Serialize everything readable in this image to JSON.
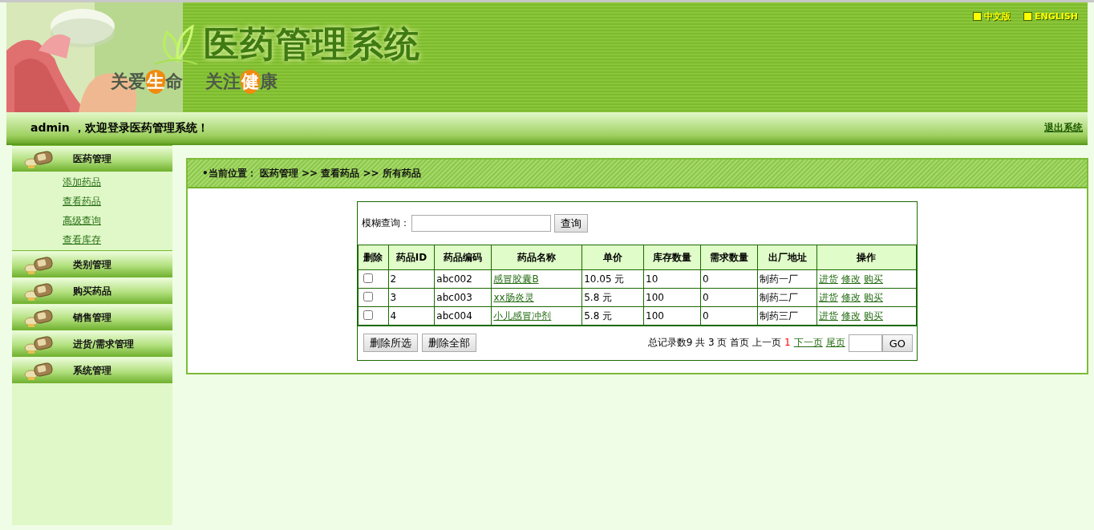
{
  "header": {
    "title": "医药管理系统",
    "slogan": [
      {
        "text": "关爱",
        "highlight": false
      },
      {
        "text": "生",
        "highlight": true
      },
      {
        "text": "命",
        "highlight": false
      },
      {
        "text": "关注",
        "highlight": false,
        "gap": true
      },
      {
        "text": "健",
        "highlight": true
      },
      {
        "text": "康",
        "highlight": false
      }
    ],
    "languages": [
      "中文版",
      "ENGLISH"
    ]
  },
  "welcome": {
    "user": "admin",
    "message": "，欢迎登录医药管理系统！",
    "logout": "退出系统"
  },
  "sidebar": {
    "items": [
      {
        "label": "医药管理",
        "expanded": true,
        "children": [
          "添加药品",
          "查看药品",
          "高级查询",
          "查看库存"
        ]
      },
      {
        "label": "类别管理",
        "expanded": false
      },
      {
        "label": "购买药品",
        "expanded": false
      },
      {
        "label": "销售管理",
        "expanded": false
      },
      {
        "label": "进货/需求管理",
        "expanded": false
      },
      {
        "label": "系统管理",
        "expanded": false
      }
    ]
  },
  "breadcrumb": "•当前位置： 医药管理 >> 查看药品 >> 所有药品",
  "search": {
    "label": "模糊查询：",
    "button": "查询"
  },
  "table": {
    "columns": [
      "删除",
      "药品ID",
      "药品编码",
      "药品名称",
      "单价",
      "库存数量",
      "需求数量",
      "出厂地址",
      "操作"
    ],
    "rows": [
      {
        "checked": false,
        "id": "2",
        "code": "abc002",
        "name": "感冒胶囊B",
        "price": "10.05 元",
        "stock": "10",
        "demand": "0",
        "factory": "制药一厂",
        "actions": [
          "进货",
          "修改",
          "购买"
        ]
      },
      {
        "checked": false,
        "id": "3",
        "code": "abc003",
        "name": "xx肠炎灵",
        "price": "5.8 元",
        "stock": "100",
        "demand": "0",
        "factory": "制药二厂",
        "actions": [
          "进货",
          "修改",
          "购买"
        ]
      },
      {
        "checked": false,
        "id": "4",
        "code": "abc004",
        "name": "小儿感冒冲剂",
        "price": "5.8 元",
        "stock": "100",
        "demand": "0",
        "factory": "制药三厂",
        "actions": [
          "进货",
          "修改",
          "购买"
        ]
      }
    ]
  },
  "buttons": [
    "删除所选",
    "删除全部"
  ],
  "pager": [
    {
      "kind": "text",
      "text": "总记录数9 共 3 页 首页 上一页"
    },
    {
      "kind": "current",
      "text": "1"
    },
    {
      "kind": "link",
      "text": "下一页"
    },
    {
      "kind": "link",
      "text": "尾页"
    }
  ],
  "go_button": "GO"
}
